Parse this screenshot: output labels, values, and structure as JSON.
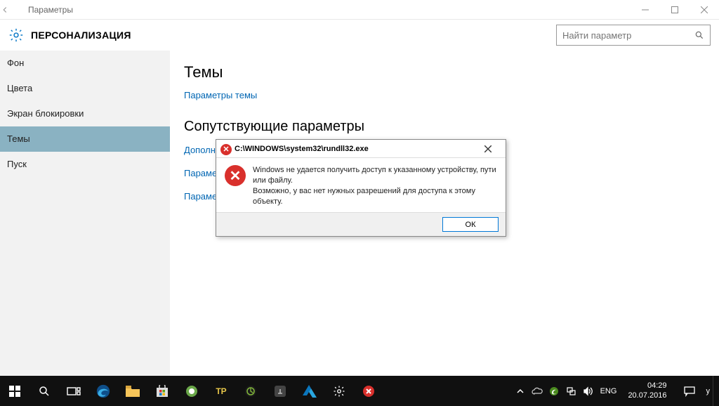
{
  "window": {
    "app_title": "Параметры",
    "header_title": "ПЕРСОНАЛИЗАЦИЯ",
    "search_placeholder": "Найти параметр"
  },
  "sidebar": {
    "items": [
      {
        "label": "Фон"
      },
      {
        "label": "Цвета"
      },
      {
        "label": "Экран блокировки"
      },
      {
        "label": "Темы"
      },
      {
        "label": "Пуск"
      }
    ]
  },
  "content": {
    "section1_title": "Темы",
    "section1_links": [
      {
        "label": "Параметры темы"
      }
    ],
    "section2_title": "Сопутствующие параметры",
    "section2_links": [
      {
        "label": "Дополн"
      },
      {
        "label": "Параме"
      },
      {
        "label": "Параме"
      }
    ]
  },
  "dialog": {
    "title": "C:\\WINDOWS\\system32\\rundll32.exe",
    "message_line1": "Windows не удается получить доступ к указанному устройству, пути или файлу.",
    "message_line2": "Возможно, у вас нет нужных разрешений для доступа к этому объекту.",
    "ok_label": "ОК"
  },
  "taskbar": {
    "lang": "ENG",
    "time": "04:29",
    "date": "20.07.2016",
    "tp_label": "TP"
  }
}
